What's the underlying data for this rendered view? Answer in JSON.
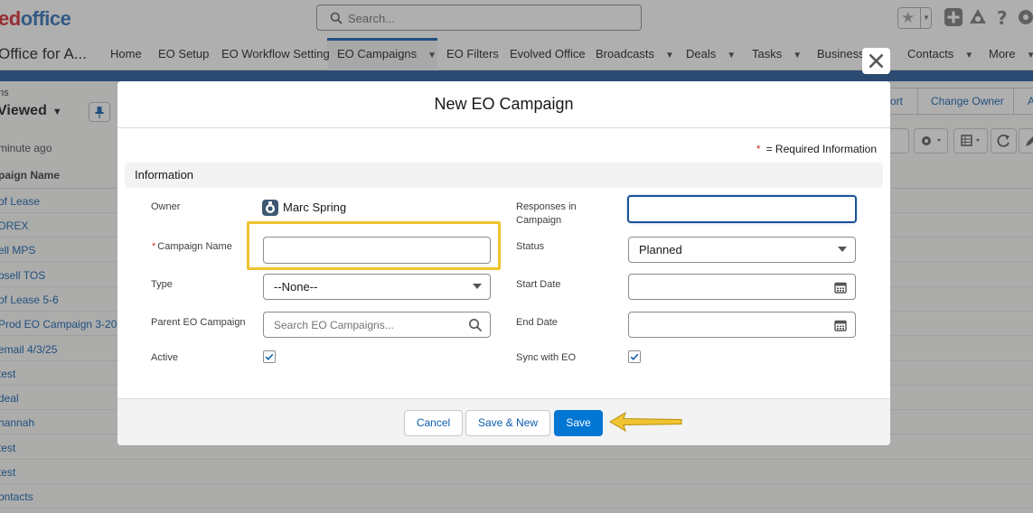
{
  "app": {
    "logo_part1": "ed",
    "logo_part2": "office",
    "app_name": "Office for A...",
    "search_placeholder": "Search..."
  },
  "nav": {
    "items": [
      {
        "label": "Home"
      },
      {
        "label": "EO Setup"
      },
      {
        "label": "EO Workflow Setting"
      },
      {
        "label": "EO Campaigns",
        "active": true,
        "dropdown": true
      },
      {
        "label": "EO Filters"
      },
      {
        "label": "Evolved Office"
      },
      {
        "label": "Broadcasts",
        "dropdown": true
      },
      {
        "label": "Deals",
        "dropdown": true
      },
      {
        "label": "Tasks",
        "dropdown": true
      },
      {
        "label": "Businesses"
      },
      {
        "label": "Contacts",
        "dropdown": true
      },
      {
        "label": "More",
        "dropdown": true
      }
    ]
  },
  "listview": {
    "breadcrumb": "ns",
    "title": "Viewed",
    "updated": "minute ago",
    "column_header": "paign Name",
    "actions": [
      "ort",
      "Change Owner",
      "A"
    ],
    "rows": [
      "of Lease",
      "DREX",
      "ell MPS",
      "psell TOS",
      "of Lease 5-6",
      "Prod EO Campaign 3-20",
      "email 4/3/25",
      "test",
      "deal",
      "hannah",
      "test",
      "test",
      "ontacts"
    ]
  },
  "modal": {
    "title": "New EO Campaign",
    "required_note": "= Required Information",
    "required_marker": "*",
    "section_title": "Information",
    "fields": {
      "owner": {
        "label": "Owner",
        "value": "Marc Spring"
      },
      "campaign_name": {
        "label": "Campaign Name",
        "value": "",
        "required": true
      },
      "type": {
        "label": "Type",
        "value": "--None--"
      },
      "parent": {
        "label": "Parent EO Campaign",
        "placeholder": "Search EO Campaigns..."
      },
      "active": {
        "label": "Active",
        "checked": true
      },
      "responses": {
        "label": "Responses in Campaign",
        "value": ""
      },
      "status": {
        "label": "Status",
        "value": "Planned"
      },
      "start_date": {
        "label": "Start Date",
        "value": ""
      },
      "end_date": {
        "label": "End Date",
        "value": ""
      },
      "sync": {
        "label": "Sync with EO",
        "checked": true
      }
    },
    "buttons": {
      "cancel": "Cancel",
      "save_new": "Save & New",
      "save": "Save"
    }
  },
  "colors": {
    "brand_blue": "#0176d3",
    "header_band": "#1b5297",
    "highlight": "#f0c330",
    "required": "#c23934"
  }
}
